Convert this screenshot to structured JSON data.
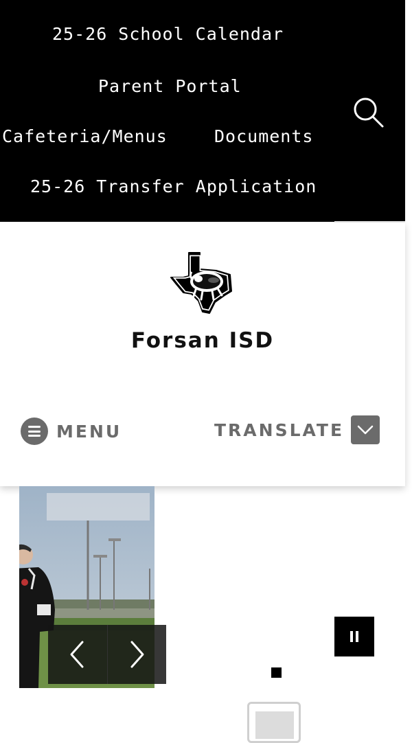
{
  "quick_links": {
    "school_calendar": "25-26 School Calendar",
    "parent_portal": "Parent Portal",
    "cafeteria_menus": "Cafeteria/Menus",
    "documents": "Documents",
    "transfer_application": "25-26 Transfer Application"
  },
  "search": {
    "icon": "search-icon"
  },
  "header": {
    "site_title": "Forsan ISD",
    "logo": "texas-buffalo-logo",
    "menu_label": "MENU",
    "translate_label": "TRANSLATE"
  },
  "slideshow": {
    "prev_icon": "chevron-left-icon",
    "next_icon": "chevron-right-icon",
    "pause_icon": "pause-icon"
  },
  "colors": {
    "topbar_bg": "#000000",
    "accent_gray": "#6b6b6b",
    "text_dark": "#111111"
  }
}
